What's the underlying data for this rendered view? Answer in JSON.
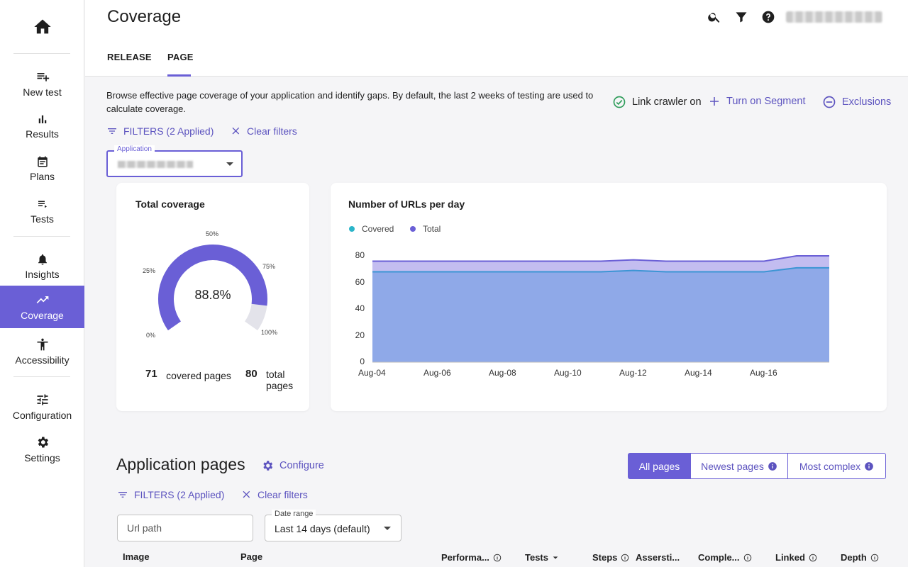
{
  "sidebar": {
    "items": [
      {
        "label": "New test",
        "icon": "playlist-add-icon"
      },
      {
        "label": "Results",
        "icon": "bar-chart-icon"
      },
      {
        "label": "Plans",
        "icon": "calendar-icon"
      },
      {
        "label": "Tests",
        "icon": "list-icon"
      },
      {
        "label": "Insights",
        "icon": "bell-icon"
      },
      {
        "label": "Coverage",
        "icon": "trending-up-icon"
      },
      {
        "label": "Accessibility",
        "icon": "accessibility-icon"
      },
      {
        "label": "Configuration",
        "icon": "sliders-icon"
      },
      {
        "label": "Settings",
        "icon": "gear-icon"
      }
    ],
    "active": "Coverage"
  },
  "header": {
    "title": "Coverage",
    "tabs": [
      {
        "label": "RELEASE"
      },
      {
        "label": "PAGE"
      }
    ],
    "active_tab": "PAGE"
  },
  "description": "Browse effective page coverage of your application and identify gaps. By default, the last 2 weeks of testing are used to calculate coverage.",
  "actions": {
    "link_crawler": "Link crawler on",
    "segment": "Turn on Segment",
    "exclusions": "Exclusions"
  },
  "filters": {
    "label": "FILTERS",
    "applied": "(2 Applied)",
    "clear": "Clear filters"
  },
  "application_select": {
    "label": "Application"
  },
  "total_coverage": {
    "title": "Total coverage",
    "percent": "88.8%",
    "fraction": 0.888,
    "ticks": {
      "t0": "0%",
      "t25": "25%",
      "t50": "50%",
      "t75": "75%",
      "t100": "100%"
    },
    "covered": "71",
    "covered_label": "covered pages",
    "total": "80",
    "total_label": "total pages"
  },
  "chart_data": {
    "type": "area",
    "title": "Number of URLs per day",
    "x": [
      "Aug-04",
      "Aug-05",
      "Aug-06",
      "Aug-07",
      "Aug-08",
      "Aug-09",
      "Aug-10",
      "Aug-11",
      "Aug-12",
      "Aug-13",
      "Aug-14",
      "Aug-15",
      "Aug-16",
      "Aug-17",
      "Aug-18"
    ],
    "xticks": [
      "Aug-04",
      "Aug-06",
      "Aug-08",
      "Aug-10",
      "Aug-12",
      "Aug-14",
      "Aug-16"
    ],
    "series": [
      {
        "name": "Covered",
        "color": "#2bb5c9",
        "values": [
          68,
          68,
          68,
          68,
          68,
          68,
          68,
          68,
          69,
          68,
          68,
          68,
          68,
          71,
          71
        ]
      },
      {
        "name": "Total",
        "color": "#6a5fd6",
        "values": [
          76,
          76,
          76,
          76,
          76,
          76,
          76,
          76,
          77,
          76,
          76,
          76,
          76,
          80,
          80
        ]
      }
    ],
    "ylim": [
      0,
      80
    ],
    "yticks": [
      0,
      20,
      40,
      60,
      80
    ],
    "legend": "top-left"
  },
  "app_pages": {
    "title": "Application pages",
    "configure": "Configure",
    "segments": [
      "All pages",
      "Newest pages",
      "Most complex"
    ],
    "active_segment": "All pages",
    "filters": {
      "label": "FILTERS",
      "applied": "(2 Applied)",
      "clear": "Clear filters"
    },
    "url_placeholder": "Url path",
    "date_range_label": "Date range",
    "date_range_value": "Last 14 days (default)",
    "columns": [
      "Image",
      "Page",
      "Performa...",
      "Tests",
      "Steps",
      "Assersti...",
      "Comple...",
      "Linked",
      "Depth"
    ]
  }
}
